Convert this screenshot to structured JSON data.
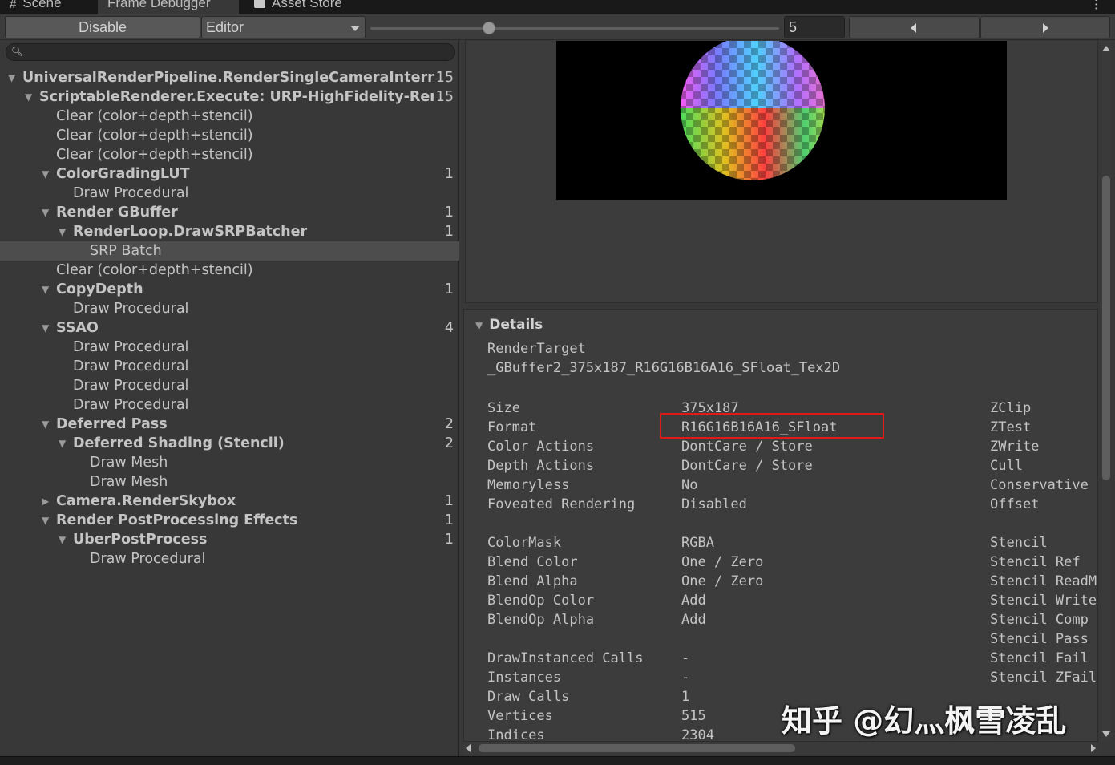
{
  "tabs": [
    {
      "icon": "hash-icon",
      "label": "Scene"
    },
    {
      "icon": "none",
      "label": "Frame Debugger"
    },
    {
      "icon": "store-bag-icon",
      "label": "Asset Store"
    }
  ],
  "toolbar": {
    "disable_label": "Disable",
    "target_selected": "Editor",
    "event_index": "5",
    "slider_fraction": 0.29
  },
  "search": {
    "placeholder": ""
  },
  "tree": [
    {
      "label": "UniversalRenderPipeline.RenderSingleCameraInternal: Main Camera",
      "count": "15",
      "depth": 0,
      "expanded": true,
      "bold": true
    },
    {
      "label": "ScriptableRenderer.Execute: URP-HighFidelity-Renderer",
      "count": "15",
      "depth": 1,
      "expanded": true,
      "bold": true
    },
    {
      "label": "Clear (color+depth+stencil)",
      "count": "",
      "depth": 2,
      "leaf": true
    },
    {
      "label": "Clear (color+depth+stencil)",
      "count": "",
      "depth": 2,
      "leaf": true
    },
    {
      "label": "Clear (color+depth+stencil)",
      "count": "",
      "depth": 2,
      "leaf": true
    },
    {
      "label": "ColorGradingLUT",
      "count": "1",
      "depth": 2,
      "expanded": true,
      "bold": true
    },
    {
      "label": "Draw Procedural",
      "count": "",
      "depth": 3,
      "leaf": true
    },
    {
      "label": "Render GBuffer",
      "count": "1",
      "depth": 2,
      "expanded": true,
      "bold": true
    },
    {
      "label": "RenderLoop.DrawSRPBatcher",
      "count": "1",
      "depth": 3,
      "expanded": true,
      "bold": true
    },
    {
      "label": "SRP Batch",
      "count": "",
      "depth": 4,
      "leaf": true,
      "selected": true
    },
    {
      "label": "Clear (color+depth+stencil)",
      "count": "",
      "depth": 2,
      "leaf": true
    },
    {
      "label": "CopyDepth",
      "count": "1",
      "depth": 2,
      "expanded": true,
      "bold": true
    },
    {
      "label": "Draw Procedural",
      "count": "",
      "depth": 3,
      "leaf": true
    },
    {
      "label": "SSAO",
      "count": "4",
      "depth": 2,
      "expanded": true,
      "bold": true
    },
    {
      "label": "Draw Procedural",
      "count": "",
      "depth": 3,
      "leaf": true
    },
    {
      "label": "Draw Procedural",
      "count": "",
      "depth": 3,
      "leaf": true
    },
    {
      "label": "Draw Procedural",
      "count": "",
      "depth": 3,
      "leaf": true
    },
    {
      "label": "Draw Procedural",
      "count": "",
      "depth": 3,
      "leaf": true
    },
    {
      "label": "Deferred Pass",
      "count": "2",
      "depth": 2,
      "expanded": true,
      "bold": true
    },
    {
      "label": "Deferred Shading (Stencil)",
      "count": "2",
      "depth": 3,
      "expanded": true,
      "bold": true
    },
    {
      "label": "Draw Mesh",
      "count": "",
      "depth": 4,
      "leaf": true
    },
    {
      "label": "Draw Mesh",
      "count": "",
      "depth": 4,
      "leaf": true
    },
    {
      "label": "Camera.RenderSkybox",
      "count": "1",
      "depth": 2,
      "expanded": false,
      "bold": true
    },
    {
      "label": "Render PostProcessing Effects",
      "count": "1",
      "depth": 2,
      "expanded": true,
      "bold": true
    },
    {
      "label": "UberPostProcess",
      "count": "1",
      "depth": 3,
      "expanded": true,
      "bold": true
    },
    {
      "label": "Draw Procedural",
      "count": "",
      "depth": 4,
      "leaf": true
    }
  ],
  "details": {
    "title": "Details",
    "render_target_label": "RenderTarget",
    "render_target_value": "_GBuffer2_375x187_R16G16B16A16_SFloat_Tex2D",
    "keys": [
      "Size",
      "Format",
      "Color Actions",
      "Depth Actions",
      "Memoryless",
      "Foveated Rendering",
      "",
      "ColorMask",
      "Blend Color",
      "Blend Alpha",
      "BlendOp Color",
      "BlendOp Alpha",
      "",
      "DrawInstanced Calls",
      "Instances",
      "Draw Calls",
      "Vertices",
      "Indices"
    ],
    "values": [
      "375x187",
      "R16G16B16A16_SFloat",
      "DontCare / Store",
      "DontCare / Store",
      "No",
      "Disabled",
      "",
      "RGBA",
      "One / Zero",
      "One / Zero",
      "Add",
      "Add",
      "",
      "-",
      "-",
      "1",
      "515",
      "2304"
    ],
    "right_keys": [
      "ZClip",
      "ZTest",
      "ZWrite",
      "Cull",
      "Conservative",
      "Offset",
      "",
      "Stencil",
      "Stencil Ref",
      "Stencil ReadMask",
      "Stencil WriteMask",
      "Stencil Comp",
      "Stencil Pass",
      "Stencil Fail",
      "Stencil ZFail"
    ],
    "highlighted_field": "Format"
  },
  "watermark": "知乎 @幻灬枫雪凌乱",
  "colors": {
    "highlight_box": "#e01919",
    "panel_bg": "#383838",
    "selected_row": "#4d4d4d"
  }
}
